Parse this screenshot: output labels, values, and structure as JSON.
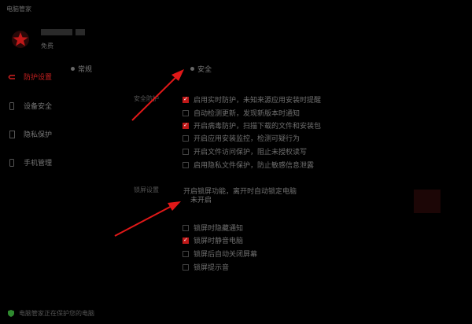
{
  "app": {
    "title": "电脑管家"
  },
  "user": {
    "name_hidden": true,
    "subtitle": "免费"
  },
  "sidebar": {
    "items": [
      {
        "label": "防护设置",
        "icon": "shield-check-icon",
        "active": true
      },
      {
        "label": "设备安全",
        "icon": "phone-icon",
        "active": false
      },
      {
        "label": "隐私保护",
        "icon": "doc-icon",
        "active": false
      },
      {
        "label": "手机管理",
        "icon": "phone-icon",
        "active": false
      }
    ]
  },
  "tabs": [
    {
      "label": "常规"
    },
    {
      "label": "安全"
    }
  ],
  "sections": {
    "first_label": "安全防护",
    "first_options": [
      {
        "label": "启用实时防护，未知来源应用安装时提醒",
        "checked": true
      },
      {
        "label": "自动检测更新，发现新版本时通知",
        "checked": false
      },
      {
        "label": "开启病毒防护，扫描下载的文件和安装包",
        "checked": true
      },
      {
        "label": "开启应用安装监控，检测可疑行为",
        "checked": false
      },
      {
        "label": "开启文件访问保护，阻止未授权读写",
        "checked": false
      },
      {
        "label": "启用隐私文件保护，防止敏感信息泄露",
        "checked": false
      }
    ],
    "second_label": "锁屏设置",
    "hint": "开启锁屏功能，离开时自动锁定电脑",
    "input_value": "未开启",
    "second_options": [
      {
        "label": "锁屏时隐藏通知",
        "checked": false
      },
      {
        "label": "锁屏时静音电脑",
        "checked": true
      },
      {
        "label": "锁屏后自动关闭屏幕",
        "checked": false
      },
      {
        "label": "锁屏提示音",
        "checked": false
      }
    ]
  },
  "footer": {
    "text": "电脑管家正在保护您的电脑"
  },
  "colors": {
    "accent": "#c01818",
    "background": "#000000"
  }
}
